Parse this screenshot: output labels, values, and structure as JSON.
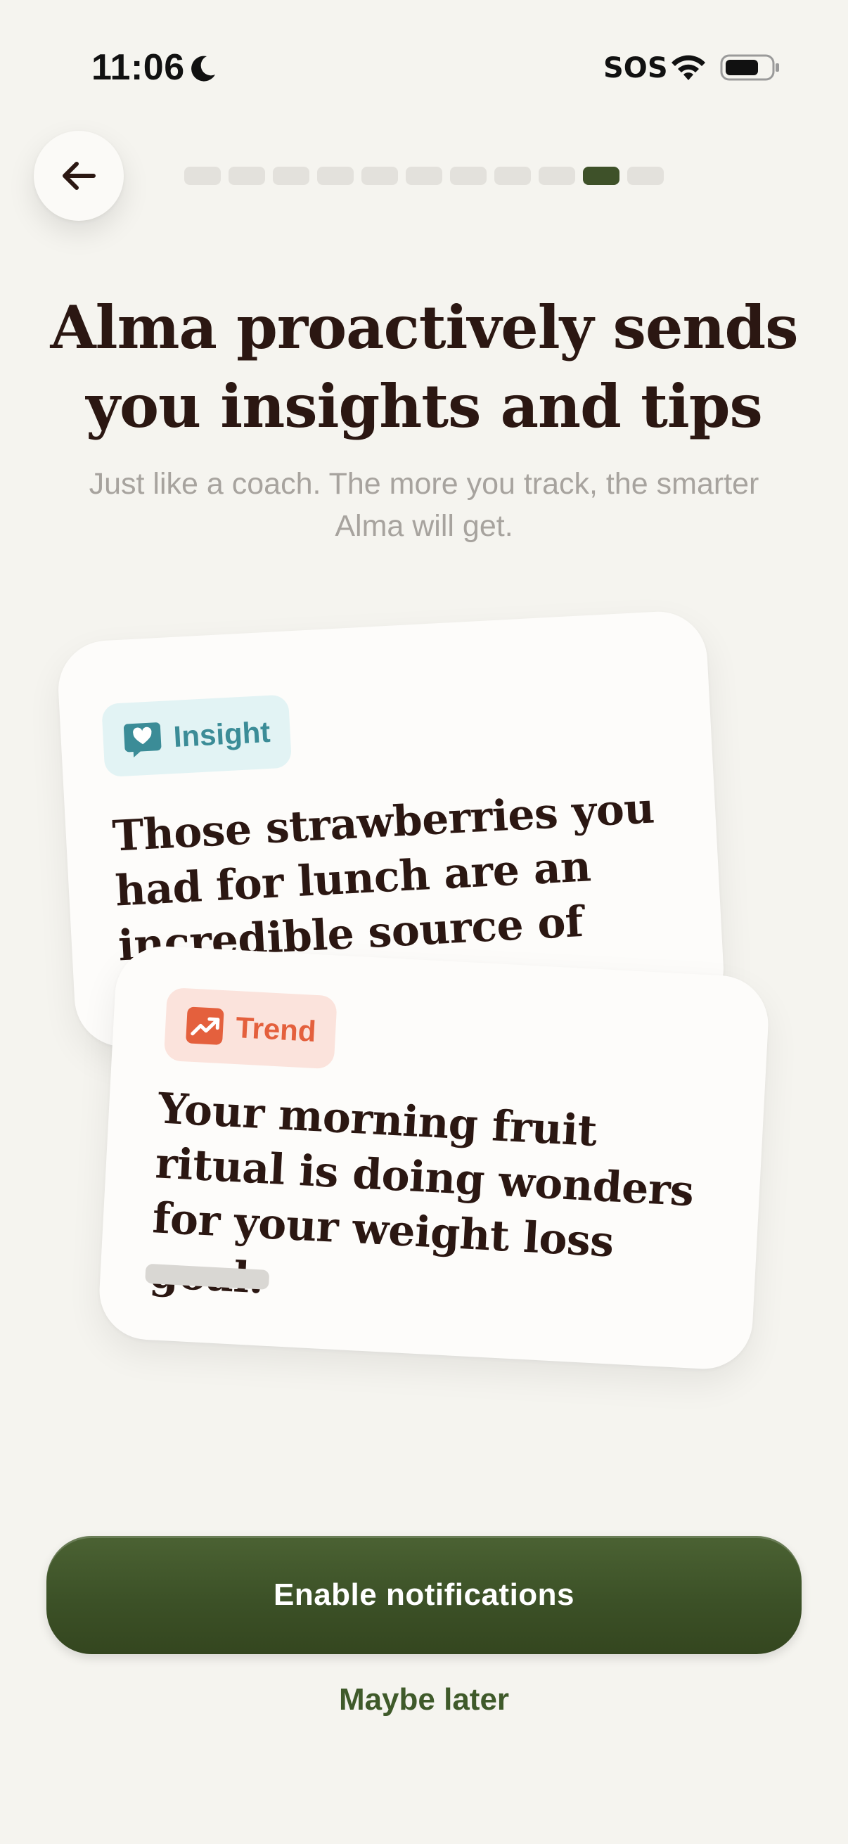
{
  "status_bar": {
    "time": "11:06",
    "carrier": "SOS",
    "icons": [
      "moon-icon",
      "wifi-icon",
      "battery-icon"
    ]
  },
  "nav": {
    "back_icon": "arrow-left-icon",
    "progress": {
      "total_steps": 11,
      "current_step": 10
    }
  },
  "header": {
    "title": "Alma proactively sends you insights and tips",
    "subtitle": "Just like a coach. The more you track, the smarter Alma will get."
  },
  "cards": {
    "insight": {
      "tag_label": "Insight",
      "tag_icon": "heart-chat-icon",
      "text": "Those strawberries you had for lunch are an incredible source of Vita..."
    },
    "trend": {
      "tag_label": "Trend",
      "tag_icon": "trend-up-icon",
      "text": "Your morning fruit ritual is doing wonders for your weight loss goal."
    }
  },
  "actions": {
    "primary_label": "Enable notifications",
    "secondary_label": "Maybe later"
  },
  "colors": {
    "background": "#f5f4ef",
    "accent_green": "#3e5129",
    "progress_inactive": "#e3e1dc",
    "insight_tag_bg": "#e2f3f4",
    "insight_tag_fg": "#3b8c97",
    "trend_tag_bg": "#fbe3dc",
    "trend_tag_fg": "#e4603d",
    "title_text": "#2b1712",
    "subtitle_text": "#a7a39e"
  }
}
